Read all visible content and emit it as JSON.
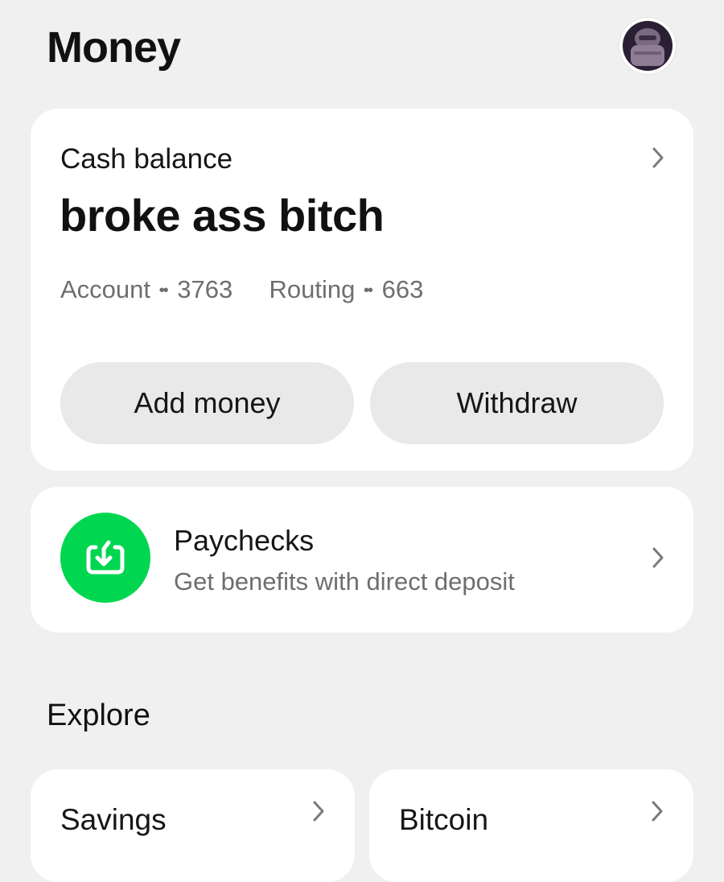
{
  "header": {
    "title": "Money",
    "avatar_icon": "profile-avatar-icon"
  },
  "balance_card": {
    "label": "Cash balance",
    "amount": "broke ass bitch",
    "account_label": "Account",
    "account_dots": "••",
    "account_number": "3763",
    "routing_label": "Routing",
    "routing_dots": "••",
    "routing_number": "663",
    "add_money_label": "Add money",
    "withdraw_label": "Withdraw"
  },
  "paychecks": {
    "title": "Paychecks",
    "subtitle": "Get benefits with direct deposit",
    "icon": "direct-deposit-icon",
    "icon_color": "#00D64F"
  },
  "explore": {
    "title": "Explore",
    "tiles": [
      {
        "label": "Savings"
      },
      {
        "label": "Bitcoin"
      }
    ]
  },
  "colors": {
    "background": "#F0F0F0",
    "card": "#FFFFFF",
    "button": "#E9E9E9",
    "accent_green": "#00D64F"
  }
}
